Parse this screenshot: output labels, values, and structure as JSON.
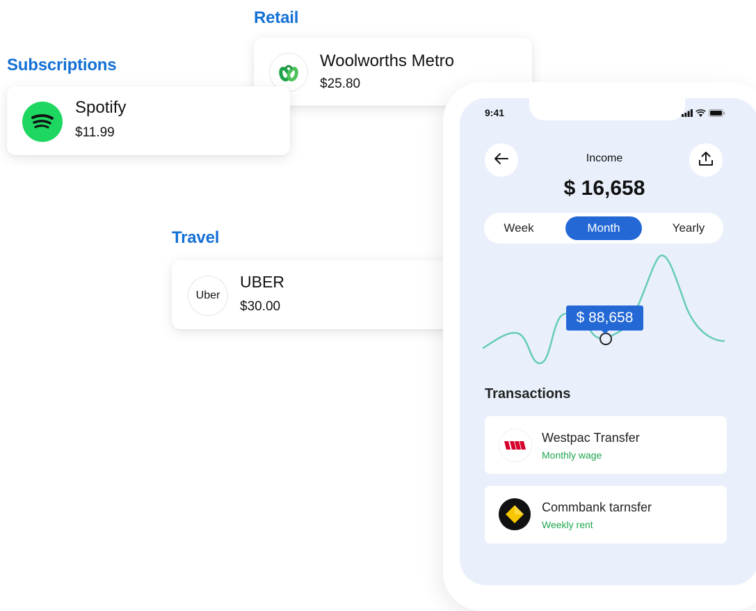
{
  "categories": {
    "subscriptions": {
      "label": "Subscriptions",
      "name": "Spotify",
      "amount": "$11.99",
      "logo_icon": "spotify-icon"
    },
    "retail": {
      "label": "Retail",
      "name": "Woolworths Metro",
      "amount": "$25.80",
      "logo_icon": "woolworths-icon"
    },
    "travel": {
      "label": "Travel",
      "name": "UBER",
      "amount": "$30.00",
      "logo_text": "Uber"
    }
  },
  "phone": {
    "status_time": "9:41",
    "title": "Income",
    "total": "$ 16,658",
    "segments": [
      "Week",
      "Month",
      "Yearly"
    ],
    "active_segment": "Month",
    "tooltip": "$ 88,658",
    "transactions_heading": "Transactions",
    "transactions": [
      {
        "name": "Westpac Transfer",
        "sub": "Monthly wage",
        "logo_icon": "westpac-icon"
      },
      {
        "name": "Commbank tarnsfer",
        "sub": "Weekly rent",
        "logo_icon": "commbank-icon"
      }
    ]
  },
  "colors": {
    "accent": "#2468d6",
    "label_blue": "#1470d6",
    "positive": "#1fa64f",
    "chart_line": "#5ec8b6",
    "screen_bg": "#e9f0fb"
  }
}
